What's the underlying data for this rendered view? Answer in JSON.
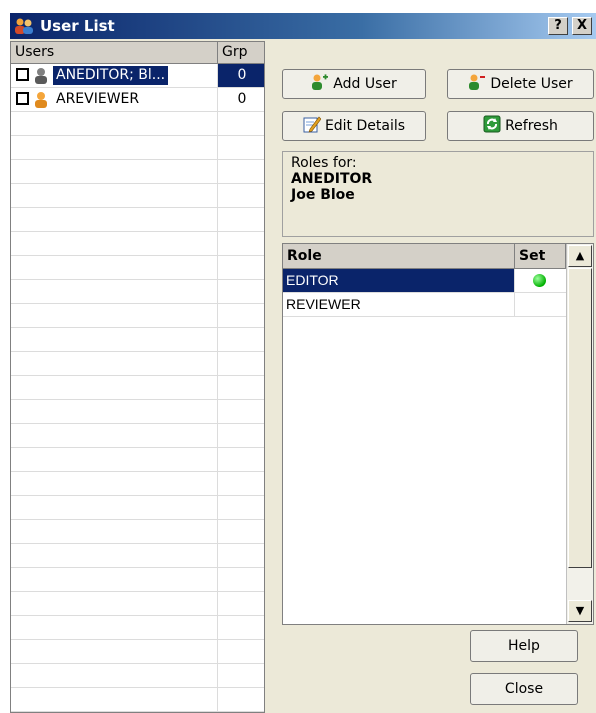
{
  "window": {
    "title": "User List",
    "help_btn": "?",
    "close_btn": "X"
  },
  "user_list": {
    "columns": [
      "Users",
      "Grp"
    ],
    "rows": [
      {
        "name": "ANEDITOR; Bl...",
        "grp": "0",
        "selected": true
      },
      {
        "name": "AREVIEWER",
        "grp": "0",
        "selected": false
      }
    ]
  },
  "buttons": {
    "add_user": "Add User",
    "delete_user": "Delete User",
    "edit_details": "Edit Details",
    "refresh": "Refresh",
    "help": "Help",
    "close": "Close"
  },
  "roles_info": {
    "label": "Roles for:",
    "user_id": "ANEDITOR",
    "user_name": "Joe Bloe"
  },
  "role_grid": {
    "columns": [
      "Role",
      "Set"
    ],
    "rows": [
      {
        "role": "EDITOR",
        "set": true,
        "selected": true
      },
      {
        "role": "REVIEWER",
        "set": false,
        "selected": false
      }
    ]
  },
  "icons": {
    "users": "users-icon",
    "user": "user-icon",
    "add": "add-user-icon",
    "delete": "delete-user-icon",
    "edit": "edit-icon",
    "refresh": "refresh-icon"
  },
  "colors": {
    "selection": "#0a246a",
    "set_indicator": "#00b000"
  }
}
